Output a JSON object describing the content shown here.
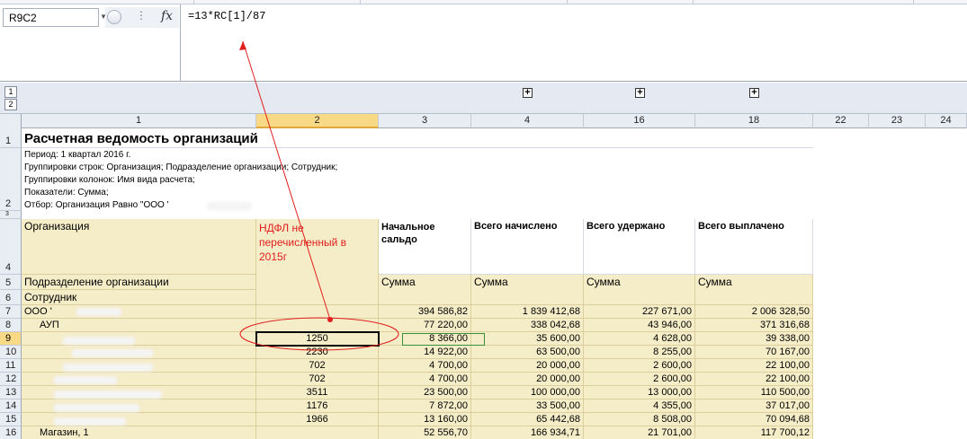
{
  "formula_bar": {
    "name_box": "R9C2",
    "fx_label": "fx",
    "formula": "=13*RC[1]/87"
  },
  "outline": {
    "levels": [
      "1",
      "2"
    ],
    "expand_symbol": "+"
  },
  "columns": [
    "1",
    "2",
    "3",
    "4",
    "16",
    "18",
    "22",
    "23",
    "24"
  ],
  "rows": [
    "1",
    "2",
    "3",
    "4",
    "5",
    "6",
    "7",
    "8",
    "9",
    "10",
    "11",
    "12",
    "13",
    "14",
    "15",
    "16"
  ],
  "report": {
    "title": "Расчетная ведомость организаций",
    "period": "Период: 1 квартал 2016 г.",
    "row_groups": "Группировки строк: Организация; Подразделение организации; Сотрудник;",
    "col_groups": "Группировки колонок: Имя вида расчета;",
    "indicators": "Показатели: Сумма;",
    "filter": "Отбор: Организация Равно \"ООО '"
  },
  "header": {
    "organization": "Организация",
    "department": "Подразделение организации",
    "employee": "Сотрудник",
    "ndfl": "НДФЛ не перечисленный в 2015г",
    "opening": "Начальное сальдо",
    "accrued": "Всего начислено",
    "withheld": "Всего удержано",
    "paid": "Всего выплачено",
    "sum": "Сумма"
  },
  "data_rows": [
    {
      "label": "ООО '",
      "ndfl": "",
      "opening": "394 586,82",
      "accrued": "1 839 412,68",
      "withheld": "227 671,00",
      "paid": "2 006 328,50"
    },
    {
      "label": "АУП",
      "ndfl": "",
      "opening": "77 220,00",
      "accrued": "338 042,68",
      "withheld": "43 946,00",
      "paid": "371 316,68"
    },
    {
      "label": "",
      "ndfl": "1250",
      "opening": "8 366,00",
      "accrued": "35 600,00",
      "withheld": "4 628,00",
      "paid": "39 338,00"
    },
    {
      "label": "",
      "ndfl": "2230",
      "opening": "14 922,00",
      "accrued": "63 500,00",
      "withheld": "8 255,00",
      "paid": "70 167,00"
    },
    {
      "label": "",
      "ndfl": "702",
      "opening": "4 700,00",
      "accrued": "20 000,00",
      "withheld": "2 600,00",
      "paid": "22 100,00"
    },
    {
      "label": "",
      "ndfl": "702",
      "opening": "4 700,00",
      "accrued": "20 000,00",
      "withheld": "2 600,00",
      "paid": "22 100,00"
    },
    {
      "label": "",
      "ndfl": "3511",
      "opening": "23 500,00",
      "accrued": "100 000,00",
      "withheld": "13 000,00",
      "paid": "110 500,00"
    },
    {
      "label": "",
      "ndfl": "1176",
      "opening": "7 872,00",
      "accrued": "33 500,00",
      "withheld": "4 355,00",
      "paid": "37 017,00"
    },
    {
      "label": "",
      "ndfl": "1966",
      "opening": "13 160,00",
      "accrued": "65 442,68",
      "withheld": "8 508,00",
      "paid": "70 094,68"
    },
    {
      "label": "Магазин, 1",
      "ndfl": "",
      "opening": "52 556,70",
      "accrued": "166 934,71",
      "withheld": "21 701,00",
      "paid": "117 700,12"
    }
  ],
  "colors": {
    "header_fill": "#f5ecc8",
    "selection_header": "#f7d986",
    "annotation": "#e0201f",
    "ndfl_text": "#e0201f"
  }
}
